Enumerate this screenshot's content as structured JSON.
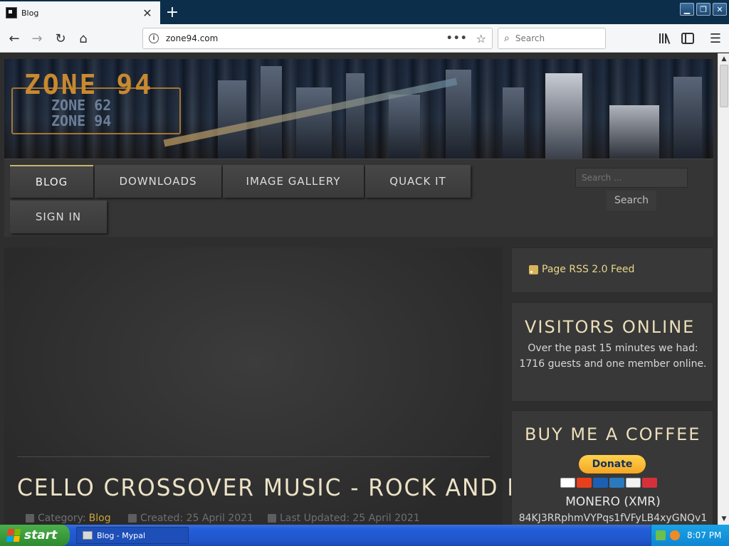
{
  "browser": {
    "tab_title": "Blog",
    "new_tab_symbol": "+",
    "url": "zone94.com",
    "search_placeholder": "Search",
    "icons": [
      "back-icon",
      "forward-icon",
      "reload-icon",
      "home-icon",
      "info-icon",
      "page-actions-icon",
      "bookmark-star-icon",
      "search-icon",
      "library-icon",
      "sidebar-icon",
      "menu-icon"
    ]
  },
  "site": {
    "logo": {
      "main": "ZONE 94",
      "sub_line1": "ZONE 62",
      "sub_line2": "ZONE 94"
    },
    "menu": [
      {
        "label": "BLOG",
        "active": true
      },
      {
        "label": "DOWNLOADS",
        "active": false
      },
      {
        "label": "IMAGE GALLERY",
        "active": false
      },
      {
        "label": "QUACK IT",
        "active": false
      },
      {
        "label": "SIGN IN",
        "active": false
      }
    ],
    "search": {
      "placeholder": "Search ...",
      "button": "Search"
    },
    "article": {
      "title": "CELLO CROSSOVER MUSIC - ROCK AND METAL",
      "category_label": "Category:",
      "category_value": "Blog",
      "created": "Created: 25 April 2021",
      "updated": "Last Updated: 25 April 2021"
    },
    "sidebar": {
      "rss_label": "Page RSS 2.0 Feed",
      "visitors_title": "VISITORS ONLINE",
      "visitors_text": "Over the past 15 minutes we had: 1716 guests and one member online.",
      "coffee_title": "BUY ME A COFFEE",
      "donate_label": "Donate",
      "monero_label": "MONERO (XMR)",
      "xmr_address": "84KJ3RRphmVYPqs1fVFyLB4xyGNQv1"
    }
  },
  "taskbar": {
    "start_label": "start",
    "task_label": "Blog - Mypal",
    "clock": "8:07 PM"
  },
  "colors": {
    "accent_gold": "#c8b46e",
    "title_text": "#ece2c6",
    "xp_blue": "#245edb",
    "xp_green": "#3c9c3c"
  }
}
